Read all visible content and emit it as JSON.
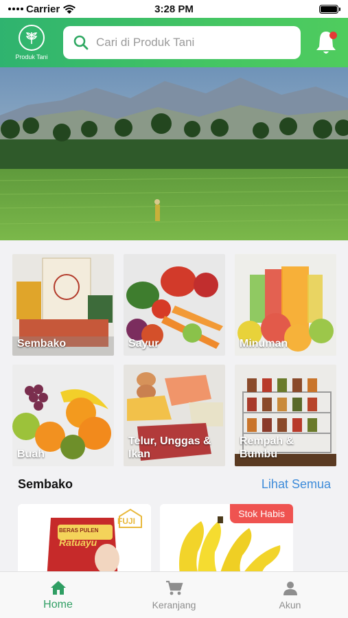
{
  "status": {
    "carrier": "Carrier",
    "time": "3:28 PM"
  },
  "header": {
    "logo_text": "Produk Tani",
    "search_placeholder": "Cari di Produk Tani"
  },
  "categories": [
    {
      "label": "Sembako"
    },
    {
      "label": "Sayur"
    },
    {
      "label": "Minuman"
    },
    {
      "label": "Buah"
    },
    {
      "label": "Telur, Unggas & Ikan"
    },
    {
      "label": "Rempah & Bumbu"
    }
  ],
  "section": {
    "title": "Sembako",
    "see_all": "Lihat Semua"
  },
  "products": [
    {
      "pack_text_1": "BERAS PULEN",
      "pack_text_2": "Ratuayu",
      "brand": "FUJI"
    },
    {
      "badge": "Stok Habis"
    }
  ],
  "nav": [
    {
      "label": "Home",
      "icon": "home-icon",
      "active": true
    },
    {
      "label": "Keranjang",
      "icon": "cart-icon"
    },
    {
      "label": "Akun",
      "icon": "user-icon"
    }
  ],
  "colors": {
    "primary": "#44c563",
    "accent_blue": "#3d8bd9",
    "badge_red": "#ef5350",
    "nav_active": "#2f9e63"
  }
}
